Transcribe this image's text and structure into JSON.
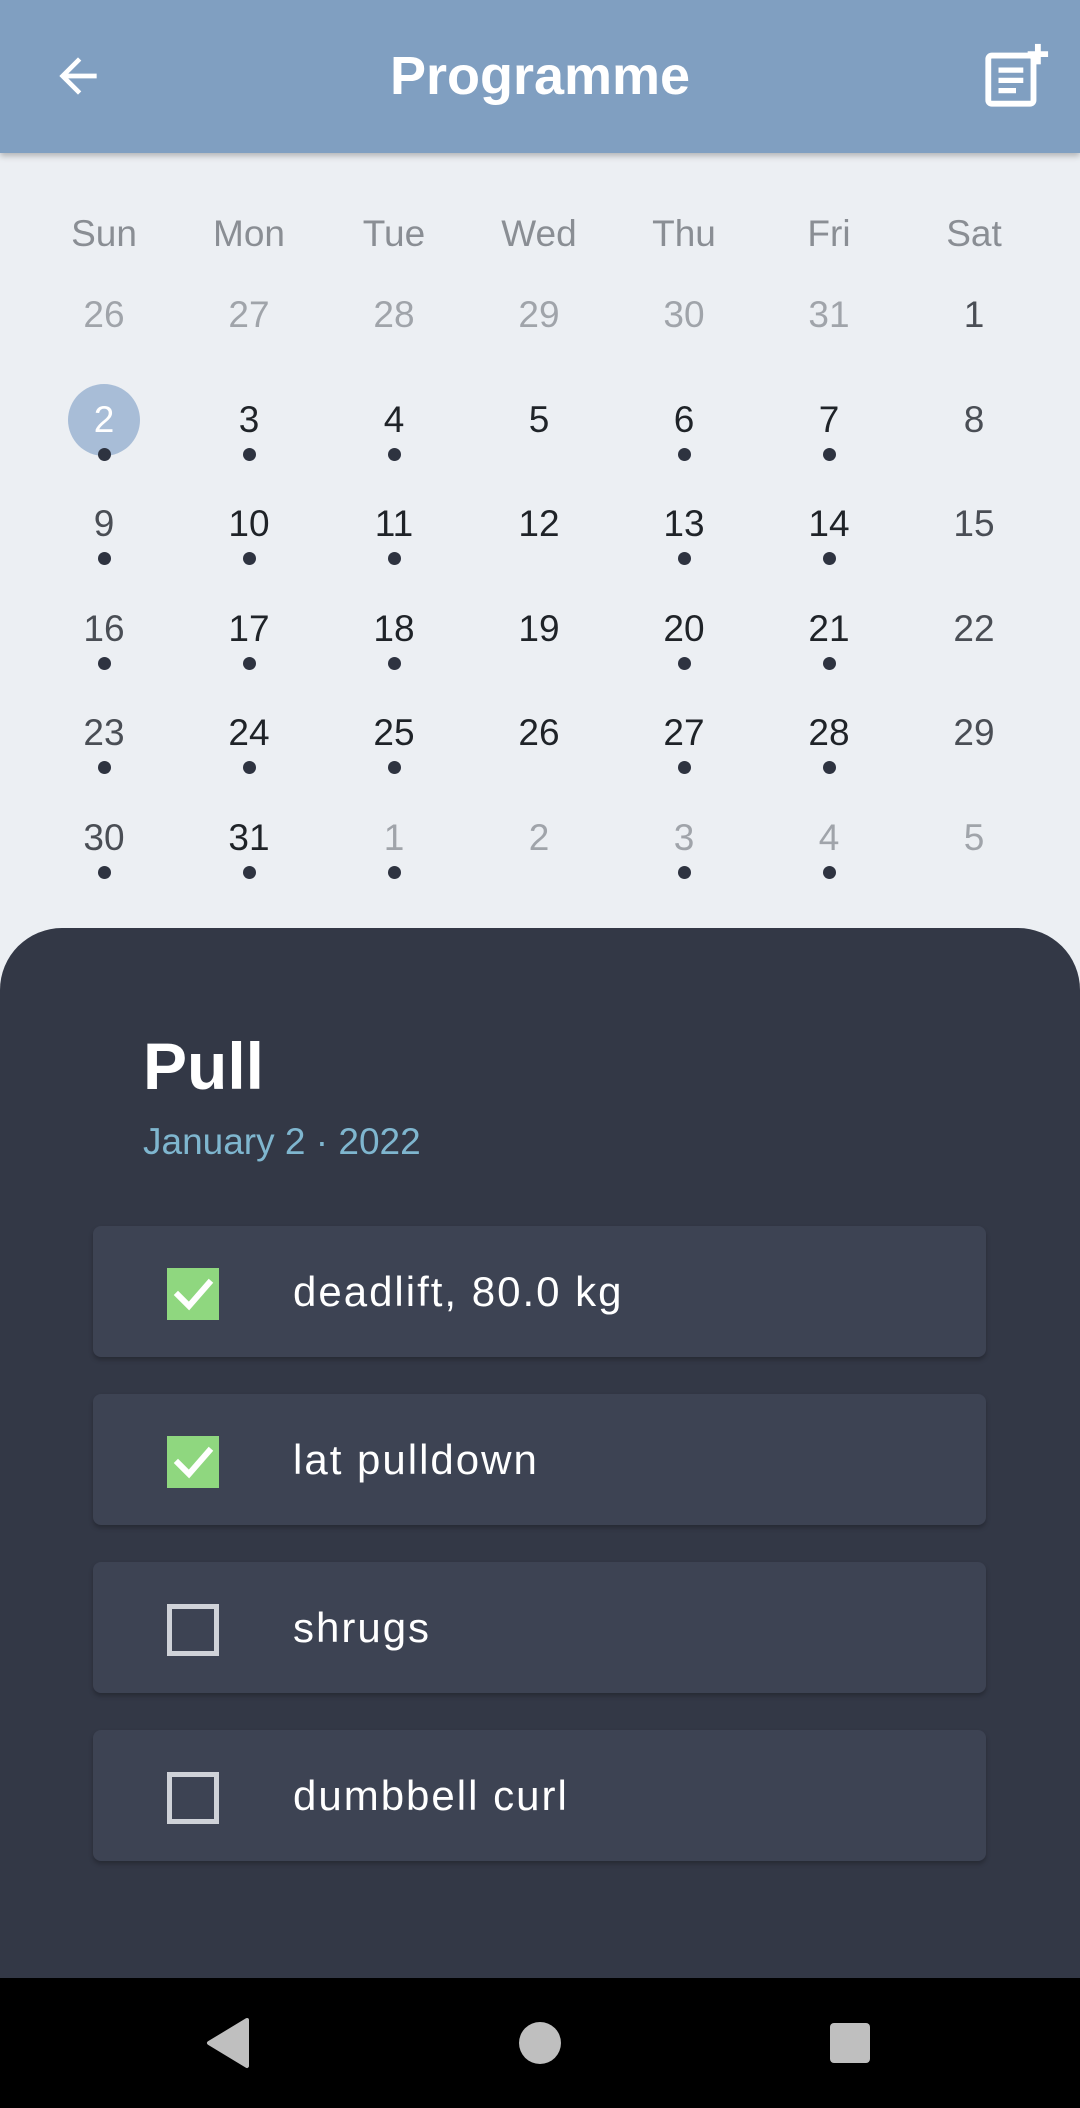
{
  "appbar": {
    "title": "Programme",
    "back_icon": "arrow-left-icon",
    "action_icon": "note-add-icon",
    "background": "#809fc1"
  },
  "calendar": {
    "weekdays": [
      "Sun",
      "Mon",
      "Tue",
      "Wed",
      "Thu",
      "Fri",
      "Sat"
    ],
    "weeks": [
      [
        {
          "day": "26",
          "out": true,
          "dot": false
        },
        {
          "day": "27",
          "out": true,
          "dot": false
        },
        {
          "day": "28",
          "out": true,
          "dot": false
        },
        {
          "day": "29",
          "out": true,
          "dot": false
        },
        {
          "day": "30",
          "out": true,
          "dot": false
        },
        {
          "day": "31",
          "out": true,
          "dot": false
        },
        {
          "day": "1",
          "out": false,
          "dot": false
        }
      ],
      [
        {
          "day": "2",
          "out": false,
          "dot": true,
          "selected": true
        },
        {
          "day": "3",
          "out": false,
          "dot": true
        },
        {
          "day": "4",
          "out": false,
          "dot": true
        },
        {
          "day": "5",
          "out": false,
          "dot": false
        },
        {
          "day": "6",
          "out": false,
          "dot": true
        },
        {
          "day": "7",
          "out": false,
          "dot": true
        },
        {
          "day": "8",
          "out": false,
          "dot": false
        }
      ],
      [
        {
          "day": "9",
          "out": false,
          "dot": true
        },
        {
          "day": "10",
          "out": false,
          "dot": true
        },
        {
          "day": "11",
          "out": false,
          "dot": true
        },
        {
          "day": "12",
          "out": false,
          "dot": false
        },
        {
          "day": "13",
          "out": false,
          "dot": true
        },
        {
          "day": "14",
          "out": false,
          "dot": true
        },
        {
          "day": "15",
          "out": false,
          "dot": false
        }
      ],
      [
        {
          "day": "16",
          "out": false,
          "dot": true
        },
        {
          "day": "17",
          "out": false,
          "dot": true
        },
        {
          "day": "18",
          "out": false,
          "dot": true
        },
        {
          "day": "19",
          "out": false,
          "dot": false
        },
        {
          "day": "20",
          "out": false,
          "dot": true
        },
        {
          "day": "21",
          "out": false,
          "dot": true
        },
        {
          "day": "22",
          "out": false,
          "dot": false
        }
      ],
      [
        {
          "day": "23",
          "out": false,
          "dot": true
        },
        {
          "day": "24",
          "out": false,
          "dot": true
        },
        {
          "day": "25",
          "out": false,
          "dot": true
        },
        {
          "day": "26",
          "out": false,
          "dot": false
        },
        {
          "day": "27",
          "out": false,
          "dot": true
        },
        {
          "day": "28",
          "out": false,
          "dot": true
        },
        {
          "day": "29",
          "out": false,
          "dot": false
        }
      ],
      [
        {
          "day": "30",
          "out": false,
          "dot": true
        },
        {
          "day": "31",
          "out": false,
          "dot": true
        },
        {
          "day": "1",
          "out": true,
          "dot": true
        },
        {
          "day": "2",
          "out": true,
          "dot": false
        },
        {
          "day": "3",
          "out": true,
          "dot": true
        },
        {
          "day": "4",
          "out": true,
          "dot": true
        },
        {
          "day": "5",
          "out": true,
          "dot": false
        }
      ]
    ],
    "selected_color": "#a8bdd7"
  },
  "workout": {
    "title": "Pull",
    "date": "January 2 · 2022",
    "exercises": [
      {
        "label": "deadlift, 80.0 kg",
        "checked": true
      },
      {
        "label": "lat pulldown",
        "checked": true
      },
      {
        "label": "shrugs",
        "checked": false
      },
      {
        "label": "dumbbell curl",
        "checked": false
      }
    ],
    "check_color": "#8fd77f"
  },
  "navbar": {
    "back_icon": "nav-back-triangle-icon",
    "home_icon": "nav-home-circle-icon",
    "recents_icon": "nav-recents-square-icon"
  }
}
